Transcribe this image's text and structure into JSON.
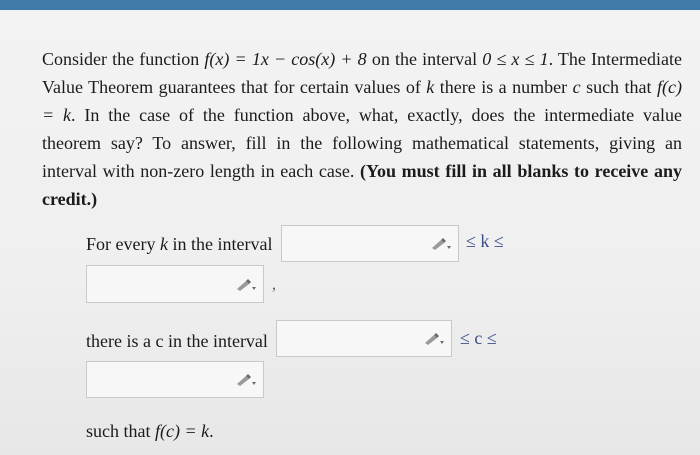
{
  "question": {
    "intro": "Consider the function ",
    "function_expr": "f(x) = 1x − cos(x) + 8",
    "interval_pre": " on the interval ",
    "interval_expr": "0 ≤ x ≤ 1",
    "sentence_tail": ". The Intermediate Value Theorem guarantees that for certain values of ",
    "k_var": "k",
    "sentence_mid": " there is a number ",
    "c_var": "c",
    "sentence_mid2": " such that ",
    "fc_expr": "f(c) = k",
    "sentence_end": ". In the case of the function above, what, exactly, does the intermediate value theorem say? To answer, fill in the following mathematical statements, giving an interval with non-zero length in each case. ",
    "emphasis": "(You must fill in all blanks to receive any credit.)"
  },
  "statements": {
    "k_row_label_pre": "For every ",
    "k_row_var": "k",
    "k_row_label_post": " in the interval",
    "k_inequality": "≤ k ≤",
    "comma": ",",
    "c_row_label": "there is a c in the interval",
    "c_inequality": "≤ c ≤",
    "final_pre": "such that ",
    "final_expr": "f(c) = k",
    "final_post": "."
  },
  "inputs": {
    "k_lower": "",
    "k_upper": "",
    "c_lower": "",
    "c_upper": ""
  },
  "icons": {
    "edit": "pencil-icon"
  },
  "colors": {
    "top_bar": "#3f7aa8",
    "inequality_text": "#3a4f8a"
  }
}
